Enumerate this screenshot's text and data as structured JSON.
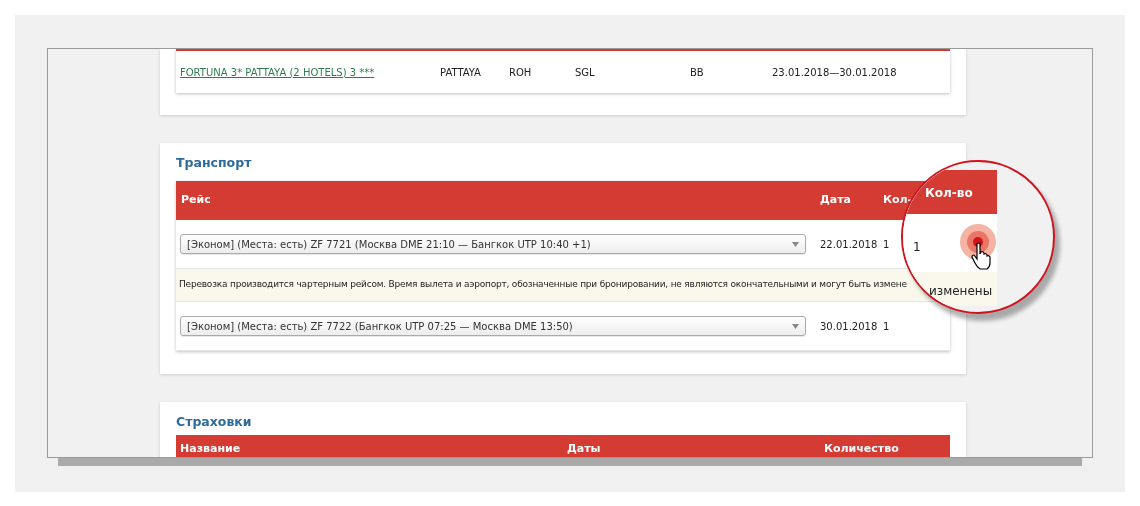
{
  "hotel_row": {
    "hotel": "FORTUNA 3* PATTAYA (2 HOTELS) 3 ***",
    "city": "PATTAYA",
    "room": "ROH",
    "accommodation": "SGL",
    "meal": "BB",
    "dates": "23.01.2018—30.01.2018"
  },
  "transport": {
    "title": "Транспорт",
    "columns": [
      "Рейс",
      "Дата",
      "Кол-"
    ],
    "rows": [
      {
        "kind": "flight",
        "value": "[Эконом] (Места: есть) ZF 7721 (Москва DME 21:10 — Бангкок UTP 10:40 +1)",
        "date": "22.01.2018",
        "count": "1"
      },
      {
        "kind": "notice",
        "text": "Перевозка производится чартерным рейсом. Время вылета и аэропорт, обозначенные при бронировании, не являются окончательными и могут быть измене"
      },
      {
        "kind": "flight",
        "value": "[Эконом] (Места: есть) ZF 7722 (Бангкок UTP 07:25 — Москва DME 13:50)",
        "date": "30.01.2018",
        "count": "1"
      }
    ]
  },
  "insurance": {
    "title": "Страховки",
    "columns": [
      "Название",
      "Даты",
      "Количество"
    ]
  },
  "magnifier": {
    "column": "Кол-во",
    "count": "1",
    "notice_end": "изменены"
  }
}
